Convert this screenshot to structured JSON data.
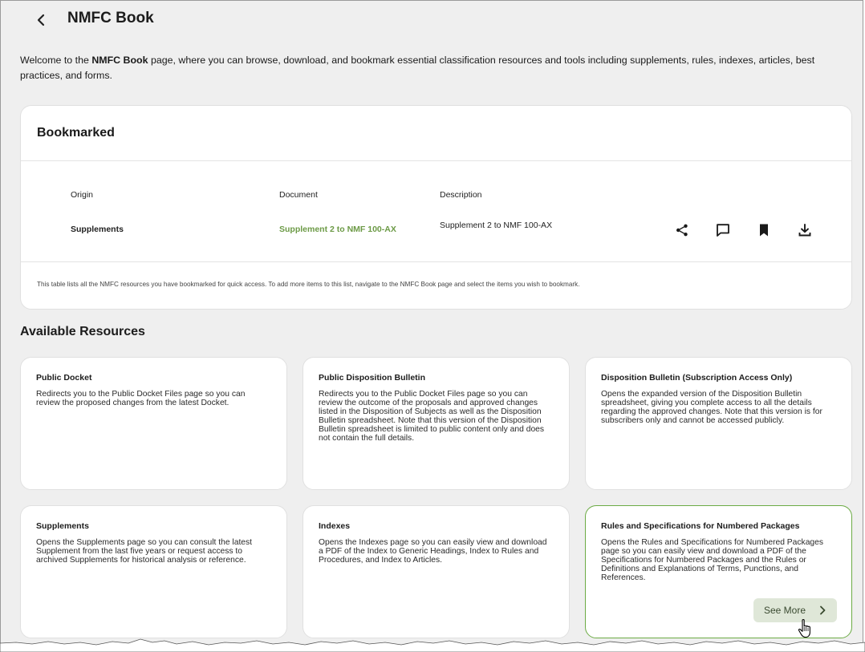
{
  "header": {
    "title": "NMFC Book"
  },
  "intro": {
    "prefix": "Welcome to the ",
    "bold": "NMFC Book",
    "suffix": " page, where you can browse, download, and bookmark essential classification resources and tools including supplements, rules, indexes, articles, best practices, and forms."
  },
  "bookmarked": {
    "title": "Bookmarked",
    "columns": {
      "origin": "Origin",
      "document": "Document",
      "description": "Description"
    },
    "rows": [
      {
        "origin": "Supplements",
        "document": "Supplement 2 to NMF 100-AX",
        "description": "Supplement 2 to NMF 100-AX"
      }
    ],
    "note": "This table lists all the NMFC resources you have bookmarked for quick access. To add more items to this list, navigate to the NMFC Book page and select the items you wish to bookmark."
  },
  "resources": {
    "title": "Available Resources",
    "cards": [
      {
        "title": "Public Docket",
        "description": "Redirects you to the Public Docket Files page so you can review the proposed changes from the latest Docket."
      },
      {
        "title": "Public Disposition Bulletin",
        "description": "Redirects you to the Public Docket Files page so you can review the outcome of the proposals and approved changes listed in the Disposition of Subjects as well as the Disposition Bulletin spreadsheet. Note that this version of the Disposition Bulletin spreadsheet is limited to public content only and does not contain the full details."
      },
      {
        "title": "Disposition Bulletin (Subscription Access Only)",
        "description": "Opens the expanded version of the Disposition Bulletin spreadsheet, giving you complete access to all the details regarding the approved changes. Note that this version is for subscribers only and cannot be accessed publicly."
      },
      {
        "title": "Supplements",
        "description": "Opens the Supplements page so you can consult the latest Supplement from the last five years or request access to archived Supplements for historical analysis or reference."
      },
      {
        "title": "Indexes",
        "description": "Opens the Indexes page so you can easily view and download a PDF of the Index to Generic Headings, Index to Rules and Procedures, and Index to Articles."
      },
      {
        "title": "Rules and Specifications for Numbered Packages",
        "description": "Opens the Rules and Specifications for Numbered Packages page so you can easily view and download a PDF of the Specifications for Numbered Packages and the Rules or Definitions and Explanations of Terms, Punctions, and References.",
        "button": "See More"
      }
    ]
  },
  "icons": {
    "back": "chevron-left-icon",
    "share": "share-icon",
    "comment": "comment-icon",
    "bookmark": "bookmark-icon",
    "download": "download-icon",
    "see_more": "chevron-right-icon",
    "cursor": "hand-pointer-icon"
  },
  "colors": {
    "page_bg": "#efefef",
    "card_bg": "#ffffff",
    "accent_green": "#6c9a46",
    "active_border": "#6cab45",
    "button_bg": "#dfe7d8"
  }
}
